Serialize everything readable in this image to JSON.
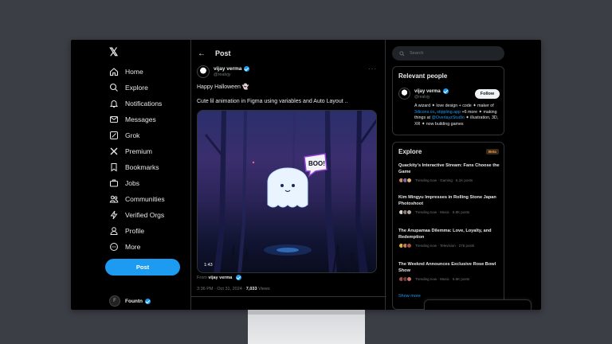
{
  "nav": {
    "logo": "𝕏",
    "items": [
      {
        "label": "Home",
        "icon": "home-icon"
      },
      {
        "label": "Explore",
        "icon": "search-icon"
      },
      {
        "label": "Notifications",
        "icon": "bell-icon"
      },
      {
        "label": "Messages",
        "icon": "mail-icon"
      },
      {
        "label": "Grok",
        "icon": "grok-icon"
      },
      {
        "label": "Premium",
        "icon": "x-premium-icon"
      },
      {
        "label": "Bookmarks",
        "icon": "bookmark-icon"
      },
      {
        "label": "Jobs",
        "icon": "briefcase-icon"
      },
      {
        "label": "Communities",
        "icon": "people-icon"
      },
      {
        "label": "Verified Orgs",
        "icon": "lightning-icon"
      },
      {
        "label": "Profile",
        "icon": "person-icon"
      },
      {
        "label": "More",
        "icon": "more-circle-icon"
      }
    ],
    "post_label": "Post",
    "account_name": "Fountn",
    "account_initial": "F"
  },
  "main": {
    "title": "Post",
    "author_name": "vijay verma",
    "author_handle": "@realvjy",
    "text_line1": "Happy Halloween 👻",
    "text_line2": "Cute lil animation in Figma using variables and Auto Layout ..",
    "media_label": "BOO!",
    "duration": "1:43",
    "from_prefix": "From",
    "from_name": "vijay verma",
    "meta_time": "3:36 PM · Oct 31, 2024 ·",
    "views_count": "7,033",
    "views_label": "Views"
  },
  "right": {
    "search_placeholder": "Search",
    "relevant_title": "Relevant people",
    "rel_name": "vijay verma",
    "rel_handle": "@realvjy",
    "follow_label": "Follow",
    "bio_part1": "A wizard ✦ love design + code ✦ maker of ",
    "bio_link1": "3dicons.co",
    "bio_part2": ", ",
    "bio_link2": "stippling.app",
    "bio_part3": " +6 more ✦ making things at ",
    "bio_link3": "@OverlayzStudio",
    "bio_part4": " ✦ illustration, 3D, XR ✦ now building games",
    "explore_title": "Explore",
    "beta_label": "Beta",
    "trends": [
      {
        "title": "Quackity's Interactive Stream: Fans Choose the Game",
        "meta": "Trending now · Gaming · 5.1K posts"
      },
      {
        "title": "Kim Mingyu Impresses in Rolling Stone Japan Photoshoot",
        "meta": "Trending now · Music · 6.8K posts"
      },
      {
        "title": "The Anupamaa Dilemma: Love, Loyalty, and Redemption",
        "meta": "Trending now · Television · 275 posts"
      },
      {
        "title": "The Weeknd Announces Exclusive Rose Bowl Show",
        "meta": "Trending now · Music · 6.6K posts"
      }
    ],
    "show_more": "Show more"
  },
  "colors": {
    "accent": "#1d9bf0",
    "background": "#000000",
    "desk_background": "#3c3e46",
    "muted_text": "#71767b"
  }
}
